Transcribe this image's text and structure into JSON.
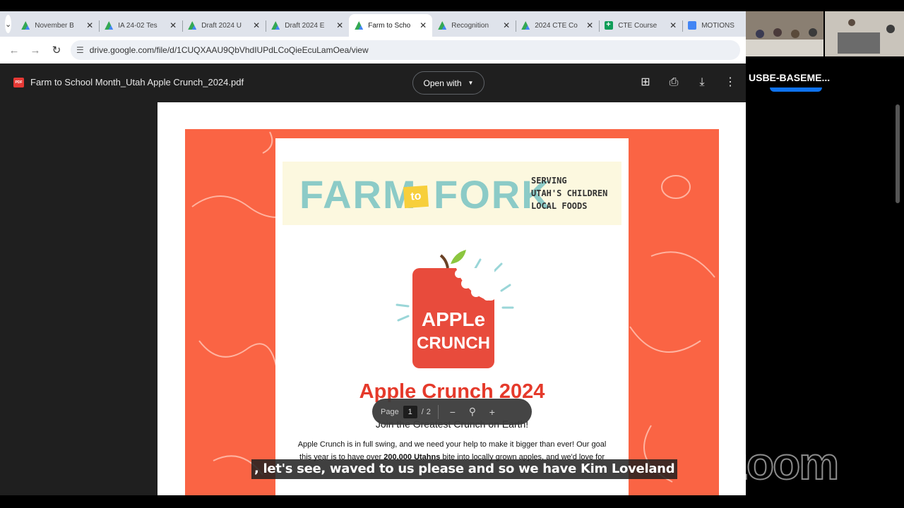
{
  "browser": {
    "tabs": [
      {
        "title": "November B",
        "icon": "drive-icon",
        "active": false
      },
      {
        "title": "IA 24-02 Tes",
        "icon": "drive-icon",
        "active": false
      },
      {
        "title": "Draft 2024 U",
        "icon": "drive-icon",
        "active": false
      },
      {
        "title": "Draft 2024 E",
        "icon": "drive-icon",
        "active": false
      },
      {
        "title": "Farm to Scho",
        "icon": "drive-icon",
        "active": true
      },
      {
        "title": "Recognition",
        "icon": "drive-icon",
        "active": false
      },
      {
        "title": "2024 CTE Co",
        "icon": "drive-icon",
        "active": false
      },
      {
        "title": "CTE Course",
        "icon": "sheets-icon",
        "active": false
      },
      {
        "title": "MOTIONS",
        "icon": "docs-icon",
        "active": false
      }
    ],
    "url": "drive.google.com/file/d/1CUQXAAU9QbVhdIUPdLCoQieEcuLamOea/view"
  },
  "viewer": {
    "file_badge": "PDF",
    "file_name": "Farm to School Month_Utah Apple Crunch_2024.pdf",
    "open_with_label": "Open with",
    "toolbar": {
      "page_label": "Page",
      "current_page": "1",
      "separator": "/",
      "total_pages": "2"
    }
  },
  "poster": {
    "farm": "FARM",
    "to": "to",
    "fork": "FORK",
    "serving": "SERVING\nUTAH'S CHILDREN\nLOCAL FOODS",
    "logo_line1": "APPLe",
    "logo_line2": "CRUNCH",
    "title": "Apple Crunch 2024",
    "subtitle": "Join the Greatest Crunch on Earth!",
    "body_line1": "Apple Crunch is in full swing, and we need your help to make it bigger than ever! Our goal",
    "body_line2_a": "this year is to have over ",
    "body_line2_bold": "200,000 Utahns",
    "body_line2_b": " bite into locally grown apples, and we'd love for"
  },
  "zoom": {
    "participant_name": "USBE-BASEME...",
    "watermark": "zoom",
    "caption": ", let's see, waved to us please and so we have Kim Loveland"
  },
  "colors": {
    "poster_bg": "#fa6444",
    "title_red": "#e53a2b",
    "banner_teal": "#8ccbc7",
    "banner_yellow": "#f7cf3b"
  }
}
